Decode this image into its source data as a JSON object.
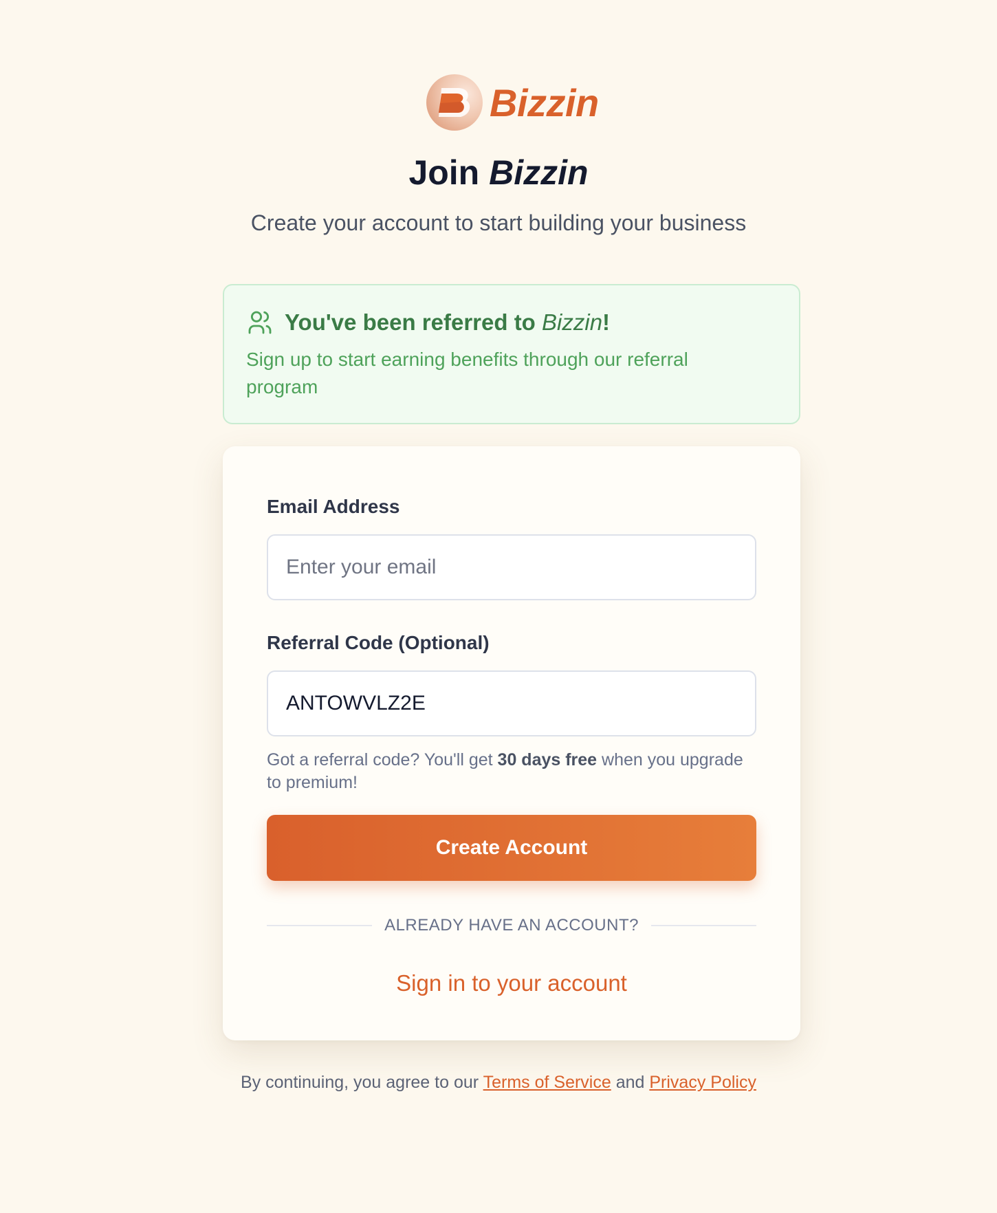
{
  "brand": {
    "name": "Bizzin",
    "accent_color": "#d9612b"
  },
  "header": {
    "title_prefix": "Join ",
    "title_brand": "Bizzin",
    "subtitle": "Create your account to start building your business"
  },
  "referral_banner": {
    "icon": "users-icon",
    "title_prefix": "You've been referred to ",
    "title_brand": "Bizzin",
    "title_suffix": "!",
    "text": "Sign up to start earning benefits through our referral program",
    "border_color": "#c9ecd1",
    "background_color": "#f1fbf1"
  },
  "form": {
    "email": {
      "label": "Email Address",
      "placeholder": "Enter your email",
      "value": ""
    },
    "referral_code": {
      "label": "Referral Code (Optional)",
      "value": "ANTOWVLZ2E"
    },
    "hint": {
      "prefix": "Got a referral code? You'll get ",
      "bold": "30 days free",
      "suffix": " when you upgrade to premium!"
    },
    "submit_label": "Create Account",
    "divider_text": "ALREADY HAVE AN ACCOUNT?",
    "signin_label": "Sign in to your account"
  },
  "footer": {
    "prefix": "By continuing, you agree to our ",
    "terms_label": "Terms of Service",
    "middle": " and ",
    "privacy_label": "Privacy Policy"
  }
}
